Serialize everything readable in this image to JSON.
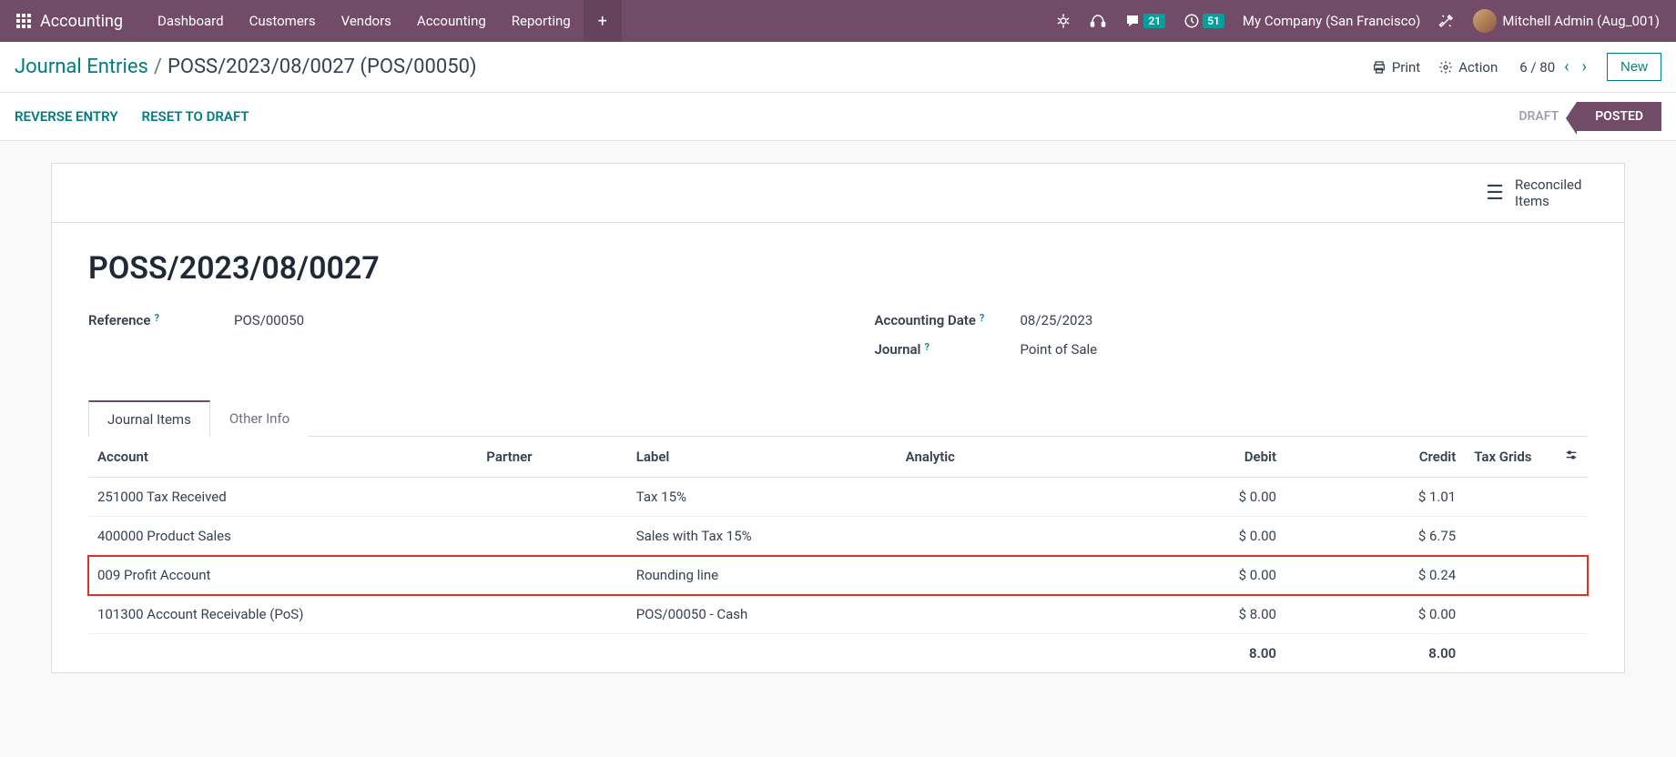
{
  "nav": {
    "brand": "Accounting",
    "items": [
      "Dashboard",
      "Customers",
      "Vendors",
      "Accounting",
      "Reporting"
    ],
    "msg_badge": "21",
    "activity_badge": "51",
    "company": "My Company (San Francisco)",
    "user": "Mitchell Admin (Aug_001)"
  },
  "breadcrumb": {
    "root": "Journal Entries",
    "current": "POSS/2023/08/0027 (POS/00050)",
    "print": "Print",
    "action": "Action",
    "pager": "6 / 80",
    "new": "New"
  },
  "actions": {
    "reverse": "REVERSE ENTRY",
    "reset": "RESET TO DRAFT",
    "status_draft": "DRAFT",
    "status_posted": "POSTED"
  },
  "card": {
    "reconciled": "Reconciled Items",
    "title": "POSS/2023/08/0027",
    "ref_label": "Reference",
    "ref_value": "POS/00050",
    "date_label": "Accounting Date",
    "date_value": "08/25/2023",
    "journal_label": "Journal",
    "journal_value": "Point of Sale"
  },
  "tabs": {
    "items": "Journal Items",
    "other": "Other Info"
  },
  "table": {
    "headers": {
      "account": "Account",
      "partner": "Partner",
      "label": "Label",
      "analytic": "Analytic",
      "debit": "Debit",
      "credit": "Credit",
      "tax": "Tax Grids"
    },
    "rows": [
      {
        "account": "251000 Tax Received",
        "partner": "",
        "label": "Tax 15%",
        "analytic": "",
        "debit": "$ 0.00",
        "credit": "$ 1.01",
        "highlight": false
      },
      {
        "account": "400000 Product Sales",
        "partner": "",
        "label": "Sales with Tax 15%",
        "analytic": "",
        "debit": "$ 0.00",
        "credit": "$ 6.75",
        "highlight": false
      },
      {
        "account": "009 Profit Account",
        "partner": "",
        "label": "Rounding line",
        "analytic": "",
        "debit": "$ 0.00",
        "credit": "$ 0.24",
        "highlight": true
      },
      {
        "account": "101300 Account Receivable (PoS)",
        "partner": "",
        "label": "POS/00050 - Cash",
        "analytic": "",
        "debit": "$ 8.00",
        "credit": "$ 0.00",
        "highlight": false
      }
    ],
    "total": {
      "debit": "8.00",
      "credit": "8.00"
    }
  }
}
